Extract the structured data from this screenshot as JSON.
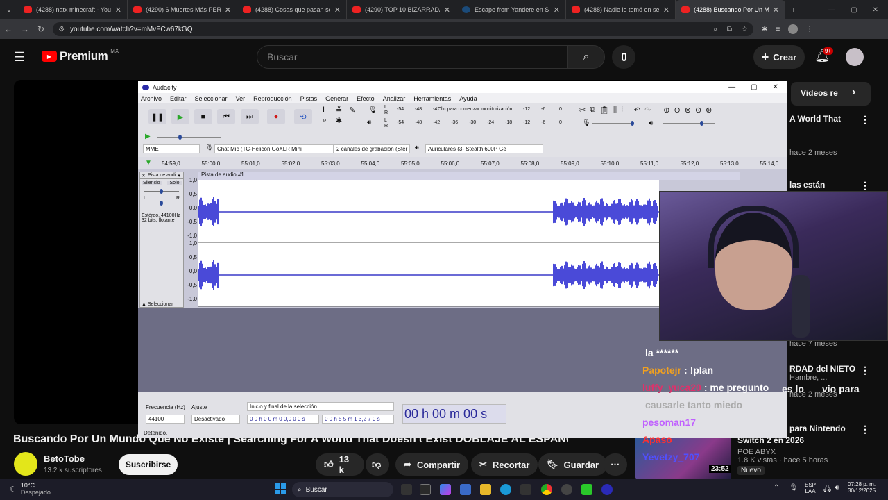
{
  "browser": {
    "tabs": [
      {
        "label": "(4288) natx minecraft - YouTub",
        "kind": "yt"
      },
      {
        "label": "(4290) 6 Muertes Más PERTURI",
        "kind": "yt"
      },
      {
        "label": "(4288) Cosas que pasan solo e",
        "kind": "yt"
      },
      {
        "label": "(4290) TOP 10 BIZARRADAS DE",
        "kind": "yt"
      },
      {
        "label": "Escape from Yandere en Steam",
        "kind": "steam"
      },
      {
        "label": "(4288) Nadie lo tomó en serio",
        "kind": "yt"
      },
      {
        "label": "(4288) Buscando Por Un Mundo",
        "kind": "yt",
        "active": true
      }
    ],
    "url": "youtube.com/watch?v=mMvFCw67kGQ"
  },
  "youtube": {
    "logo": "Premium",
    "region": "MX",
    "search_placeholder": "Buscar",
    "create_label": "Crear",
    "notif_count": "9+",
    "video_title": "Buscando Por Un Mundo Que No Existe | Searching For A World That Doesn't Exist DOBLAJE AL ESPAÑOL",
    "channel": "BetoTobe",
    "subscribers": "13.2 k suscriptores",
    "subscribe_label": "Suscribirse",
    "likes": "13 k",
    "share_label": "Compartir",
    "clip_label": "Recortar",
    "save_label": "Guardar",
    "sidebar_header": "Videos re",
    "sidebar": [
      {
        "title": "A World That",
        "meta": "hace 2 meses"
      },
      {
        "title": "las están",
        "meta": ""
      },
      {
        "title": "",
        "meta": "hace 7 meses"
      },
      {
        "title": "RDAD del NIETO",
        "meta": "hace 2 meses",
        "sub": "Hambre, ..."
      },
      {
        "title": "para Nintendo",
        "meta": ""
      },
      {
        "title": "Switch 2 en 2026",
        "meta": "1.8 K vistas · hace 5 horas",
        "sub": "POE ABYX",
        "badge": "Nuevo"
      }
    ]
  },
  "audacity": {
    "title": "Audacity",
    "menu": [
      "Archivo",
      "Editar",
      "Seleccionar",
      "Ver",
      "Reproducción",
      "Pistas",
      "Generar",
      "Efecto",
      "Analizar",
      "Herramientas",
      "Ayuda"
    ],
    "meter_hint": "Clic para comenzar monitorización",
    "meter_ticks": [
      "-54",
      "-48",
      "-42",
      "-36",
      "-30",
      "-24",
      "-18",
      "-12",
      "-6",
      "0"
    ],
    "host": "MME",
    "input_device": "Chat Mic (TC-Helicon GoXLR Mini",
    "channels": "2 canales de grabación (Ster",
    "output_device": "Auriculares (3- Stealth 600P Ge",
    "timeline": [
      "54:59,0",
      "55:00,0",
      "55:01,0",
      "55:02,0",
      "55:03,0",
      "55:04,0",
      "55:05,0",
      "55:06,0",
      "55:07,0",
      "55:08,0",
      "55:09,0",
      "55:10,0",
      "55:11,0",
      "55:12,0",
      "55:13,0",
      "55:14,0"
    ],
    "track_name": "Pista de audi",
    "track_title": "Pista de audio #1",
    "mute_label": "Silencio",
    "solo_label": "Solo",
    "track_info": "Estéreo, 44100Hz",
    "track_info2": "32 bits, flotante",
    "select_label": "Seleccionar",
    "scale": [
      "1,0",
      "0,5",
      "0,0",
      "-0,5",
      "-1,0"
    ],
    "freq_label": "Frecuencia (Hz)",
    "freq_value": "44100",
    "snap_label": "Ajuste",
    "snap_value": "Desactivado",
    "selection_label": "Inicio y final de la selección",
    "sel_start": "0 0 h 0 0 m 0 0,0 0 0 s",
    "sel_end": "0 0 h 5 5 m 1 3,2 7 0 s",
    "time_display": "00 h 00 m 00 s",
    "status": "Detenido."
  },
  "chat": [
    {
      "user": "",
      "text": "la ******",
      "color": "#ffffff"
    },
    {
      "user": "Papotejr",
      "text": ": !plan",
      "color": "#f0a020"
    },
    {
      "user": "luffy_yuca20",
      "text": ": me pregunto",
      "color": "#e0306a"
    },
    {
      "user": "",
      "text": "causarle tanto miedo",
      "color": "#aaaaaa"
    },
    {
      "user": "pesoman17",
      "text": "",
      "color": "#c060ff"
    },
    {
      "user": "Apaso",
      "text": "",
      "color": "#ff3030"
    },
    {
      "user": "Yevetzy_707",
      "text": "",
      "color": "#5050ff"
    }
  ],
  "chat_extra": "es lo",
  "chat_extra2": "vio para",
  "taskbar": {
    "weather_temp": "10°C",
    "weather_desc": "Despejado",
    "search": "Buscar",
    "lang": "ESP",
    "lang2": "LAA",
    "time": "07:28 p. m.",
    "date": "30/12/2025",
    "overlay_time": "23:52"
  }
}
